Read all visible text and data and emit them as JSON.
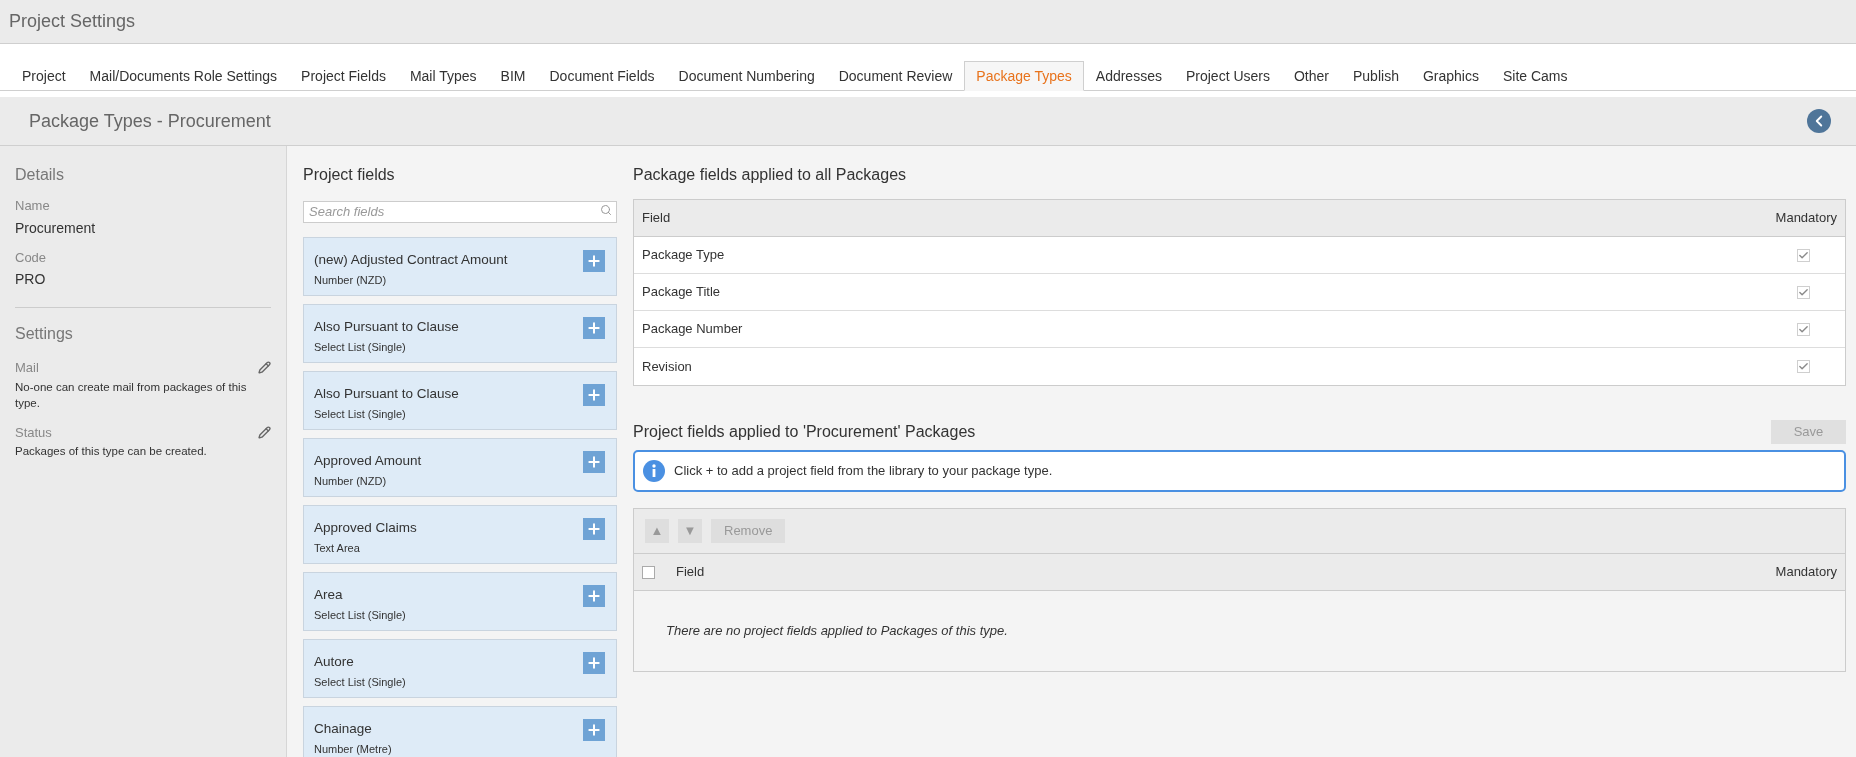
{
  "window": {
    "title": "Project Settings"
  },
  "tabs": [
    {
      "label": "Project",
      "selected": false
    },
    {
      "label": "Mail/Documents Role Settings",
      "selected": false
    },
    {
      "label": "Project Fields",
      "selected": false
    },
    {
      "label": "Mail Types",
      "selected": false
    },
    {
      "label": "BIM",
      "selected": false
    },
    {
      "label": "Document Fields",
      "selected": false
    },
    {
      "label": "Document Numbering",
      "selected": false
    },
    {
      "label": "Document Review",
      "selected": false
    },
    {
      "label": "Package Types",
      "selected": true
    },
    {
      "label": "Addresses",
      "selected": false
    },
    {
      "label": "Project Users",
      "selected": false
    },
    {
      "label": "Other",
      "selected": false
    },
    {
      "label": "Publish",
      "selected": false
    },
    {
      "label": "Graphics",
      "selected": false
    },
    {
      "label": "Site Cams",
      "selected": false
    }
  ],
  "page_header": {
    "title": "Package Types - Procurement"
  },
  "details": {
    "heading": "Details",
    "items": [
      {
        "label": "Name",
        "value": "Procurement"
      },
      {
        "label": "Code",
        "value": "PRO"
      }
    ]
  },
  "settings": {
    "heading": "Settings",
    "items": [
      {
        "label": "Mail",
        "value": "No-one can create mail from packages of this type."
      },
      {
        "label": "Status",
        "value": "Packages of this type can be created."
      }
    ]
  },
  "project_fields": {
    "heading": "Project fields",
    "search": {
      "placeholder": "Search fields"
    },
    "items": [
      {
        "name": "(new) Adjusted Contract Amount",
        "type": "Number (NZD)"
      },
      {
        "name": "Also Pursuant to Clause",
        "type": "Select List (Single)"
      },
      {
        "name": "Also Pursuant to Clause",
        "type": "Select List (Single)"
      },
      {
        "name": "Approved Amount",
        "type": "Number (NZD)"
      },
      {
        "name": "Approved Claims",
        "type": "Text Area"
      },
      {
        "name": "Area",
        "type": "Select List (Single)"
      },
      {
        "name": "Autore",
        "type": "Select List (Single)"
      },
      {
        "name": "Chainage",
        "type": "Number (Metre)"
      }
    ]
  },
  "all_packages": {
    "heading": "Package fields applied to all Packages",
    "columns": [
      "Field",
      "Mandatory"
    ],
    "rows": [
      {
        "field": "Package Type",
        "checked": true
      },
      {
        "field": "Package Title",
        "checked": true
      },
      {
        "field": "Package Number",
        "checked": true
      },
      {
        "field": "Revision",
        "checked": true
      }
    ]
  },
  "type_packages": {
    "heading": "Project fields applied to 'Procurement' Packages",
    "save": {
      "label": "Save",
      "disabled": true
    },
    "info": "Click + to add a project field from the library to your package type.",
    "toolbar": [
      {
        "label": "▲",
        "kind": "arrow",
        "disabled": true
      },
      {
        "label": "▼",
        "kind": "arrow",
        "disabled": true
      },
      {
        "label": "Remove",
        "kind": "text",
        "disabled": true
      }
    ],
    "select_all": {
      "checked": false
    },
    "columns": [
      "Field",
      "Mandatory"
    ],
    "empty": "There are no project fields applied to Packages of this type."
  }
}
